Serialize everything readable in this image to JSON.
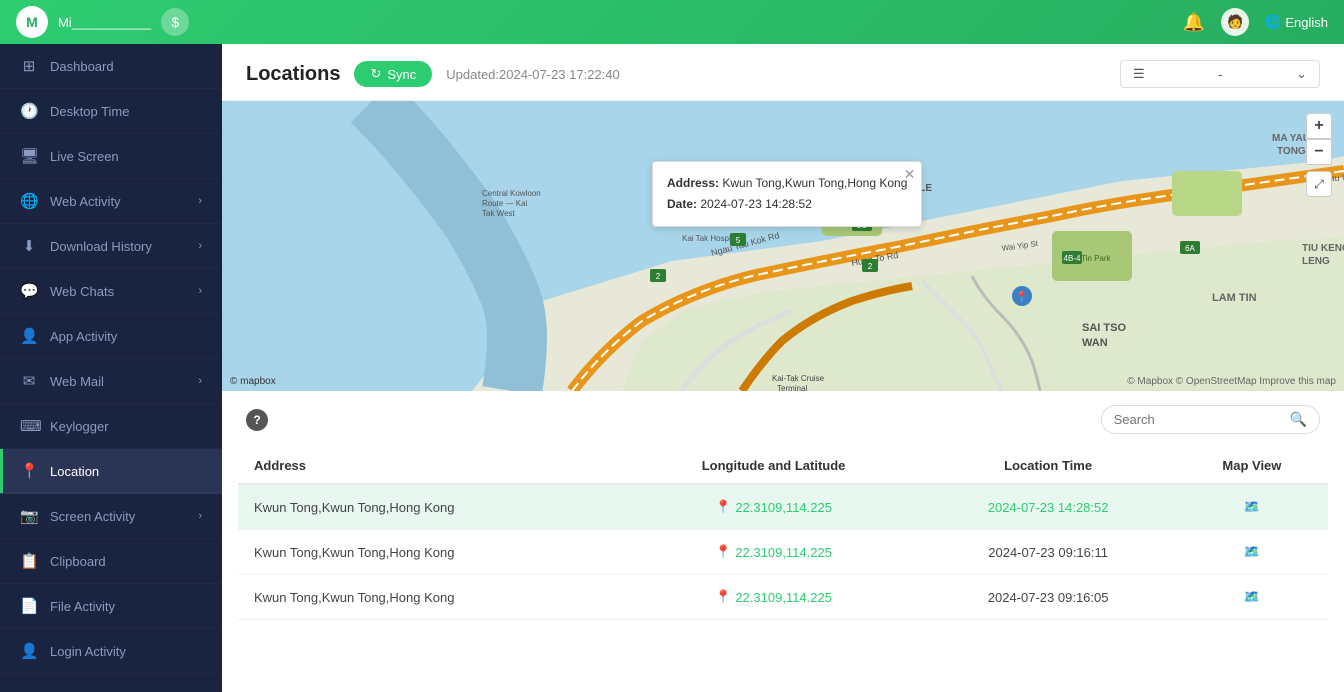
{
  "topbar": {
    "username": "Mi___________",
    "coin_icon": "💲",
    "lang": "English",
    "bell_icon": "🔔"
  },
  "sidebar": {
    "items": [
      {
        "id": "dashboard",
        "label": "Dashboard",
        "icon": "⊞",
        "active": false,
        "has_chevron": false
      },
      {
        "id": "desktop-time",
        "label": "Desktop Time",
        "icon": "🕐",
        "active": false,
        "has_chevron": false
      },
      {
        "id": "live-screen",
        "label": "Live Screen",
        "icon": "🖥",
        "active": false,
        "has_chevron": false
      },
      {
        "id": "web-activity",
        "label": "Web Activity",
        "icon": "🌐",
        "active": false,
        "has_chevron": true
      },
      {
        "id": "download-history",
        "label": "Download History",
        "icon": "⬇",
        "active": false,
        "has_chevron": true
      },
      {
        "id": "web-chats",
        "label": "Web Chats",
        "icon": "💬",
        "active": false,
        "has_chevron": true
      },
      {
        "id": "app-activity",
        "label": "App Activity",
        "icon": "👤",
        "active": false,
        "has_chevron": false
      },
      {
        "id": "web-mail",
        "label": "Web Mail",
        "icon": "✉",
        "active": false,
        "has_chevron": true
      },
      {
        "id": "keylogger",
        "label": "Keylogger",
        "icon": "⌨",
        "active": false,
        "has_chevron": false
      },
      {
        "id": "location",
        "label": "Location",
        "icon": "📍",
        "active": true,
        "has_chevron": false
      },
      {
        "id": "screen-activity",
        "label": "Screen Activity",
        "icon": "📷",
        "active": false,
        "has_chevron": true
      },
      {
        "id": "clipboard",
        "label": "Clipboard",
        "icon": "📋",
        "active": false,
        "has_chevron": false
      },
      {
        "id": "file-activity",
        "label": "File Activity",
        "icon": "📄",
        "active": false,
        "has_chevron": false
      },
      {
        "id": "login-activity",
        "label": "Login Activity",
        "icon": "👤",
        "active": false,
        "has_chevron": false
      }
    ]
  },
  "page": {
    "title": "Locations",
    "sync_label": "Sync",
    "updated_text": "Updated:2024-07-23 17:22:40",
    "dropdown_placeholder": "-"
  },
  "map": {
    "popup": {
      "address_label": "Address:",
      "address_value": "Kwun Tong,Kwun Tong,Hong Kong",
      "date_label": "Date:",
      "date_value": "2024-07-23 14:28:52"
    },
    "attribution": "© Mapbox © OpenStreetMap  Improve this map",
    "logo": "© mapbox"
  },
  "table": {
    "search_placeholder": "Search",
    "columns": [
      "Address",
      "Longitude and Latitude",
      "Location Time",
      "Map View"
    ],
    "rows": [
      {
        "address": "Kwun Tong,Kwun Tong,Hong Kong",
        "coords": "22.3109,114.225",
        "time": "2024-07-23 14:28:52",
        "highlighted": true
      },
      {
        "address": "Kwun Tong,Kwun Tong,Hong Kong",
        "coords": "22.3109,114.225",
        "time": "2024-07-23 09:16:11",
        "highlighted": false
      },
      {
        "address": "Kwun Tong,Kwun Tong,Hong Kong",
        "coords": "22.3109,114.225",
        "time": "2024-07-23 09:16:05",
        "highlighted": false
      }
    ]
  }
}
